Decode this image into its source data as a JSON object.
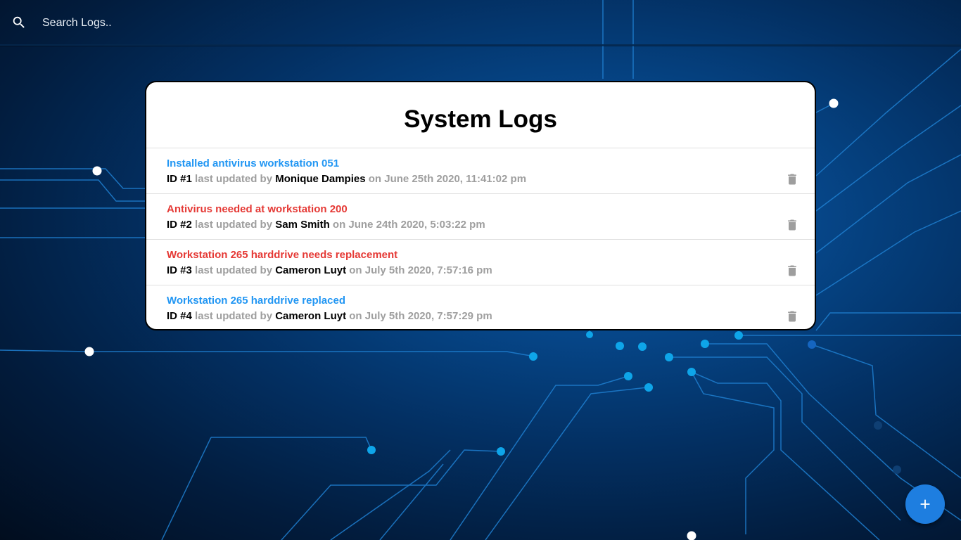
{
  "search": {
    "placeholder": "Search Logs.."
  },
  "card": {
    "title": "System Logs"
  },
  "labels": {
    "id_prefix": "ID #",
    "updated_by": " last updated by ",
    "on": " on "
  },
  "logs": [
    {
      "id": "1",
      "message": "Installed antivirus workstation 051",
      "attention": false,
      "tech": "Monique Dampies",
      "date": "June 25th 2020, 11:41:02 pm"
    },
    {
      "id": "2",
      "message": "Antivirus needed at workstation 200",
      "attention": true,
      "tech": "Sam Smith",
      "date": "June 24th 2020, 5:03:22 pm"
    },
    {
      "id": "3",
      "message": "Workstation 265 harddrive needs replacement",
      "attention": true,
      "tech": "Cameron Luyt",
      "date": "July 5th 2020, 7:57:16 pm"
    },
    {
      "id": "4",
      "message": "Workstation 265 harddrive replaced",
      "attention": false,
      "tech": "Cameron Luyt",
      "date": "July 5th 2020, 7:57:29 pm"
    }
  ],
  "colors": {
    "normal_message": "#2196f3",
    "attention_message": "#e53935",
    "muted_text": "#9e9e9e",
    "fab": "#1e7ee0"
  },
  "icons": {
    "search": "search-icon",
    "delete": "delete-icon",
    "add": "add-icon"
  }
}
